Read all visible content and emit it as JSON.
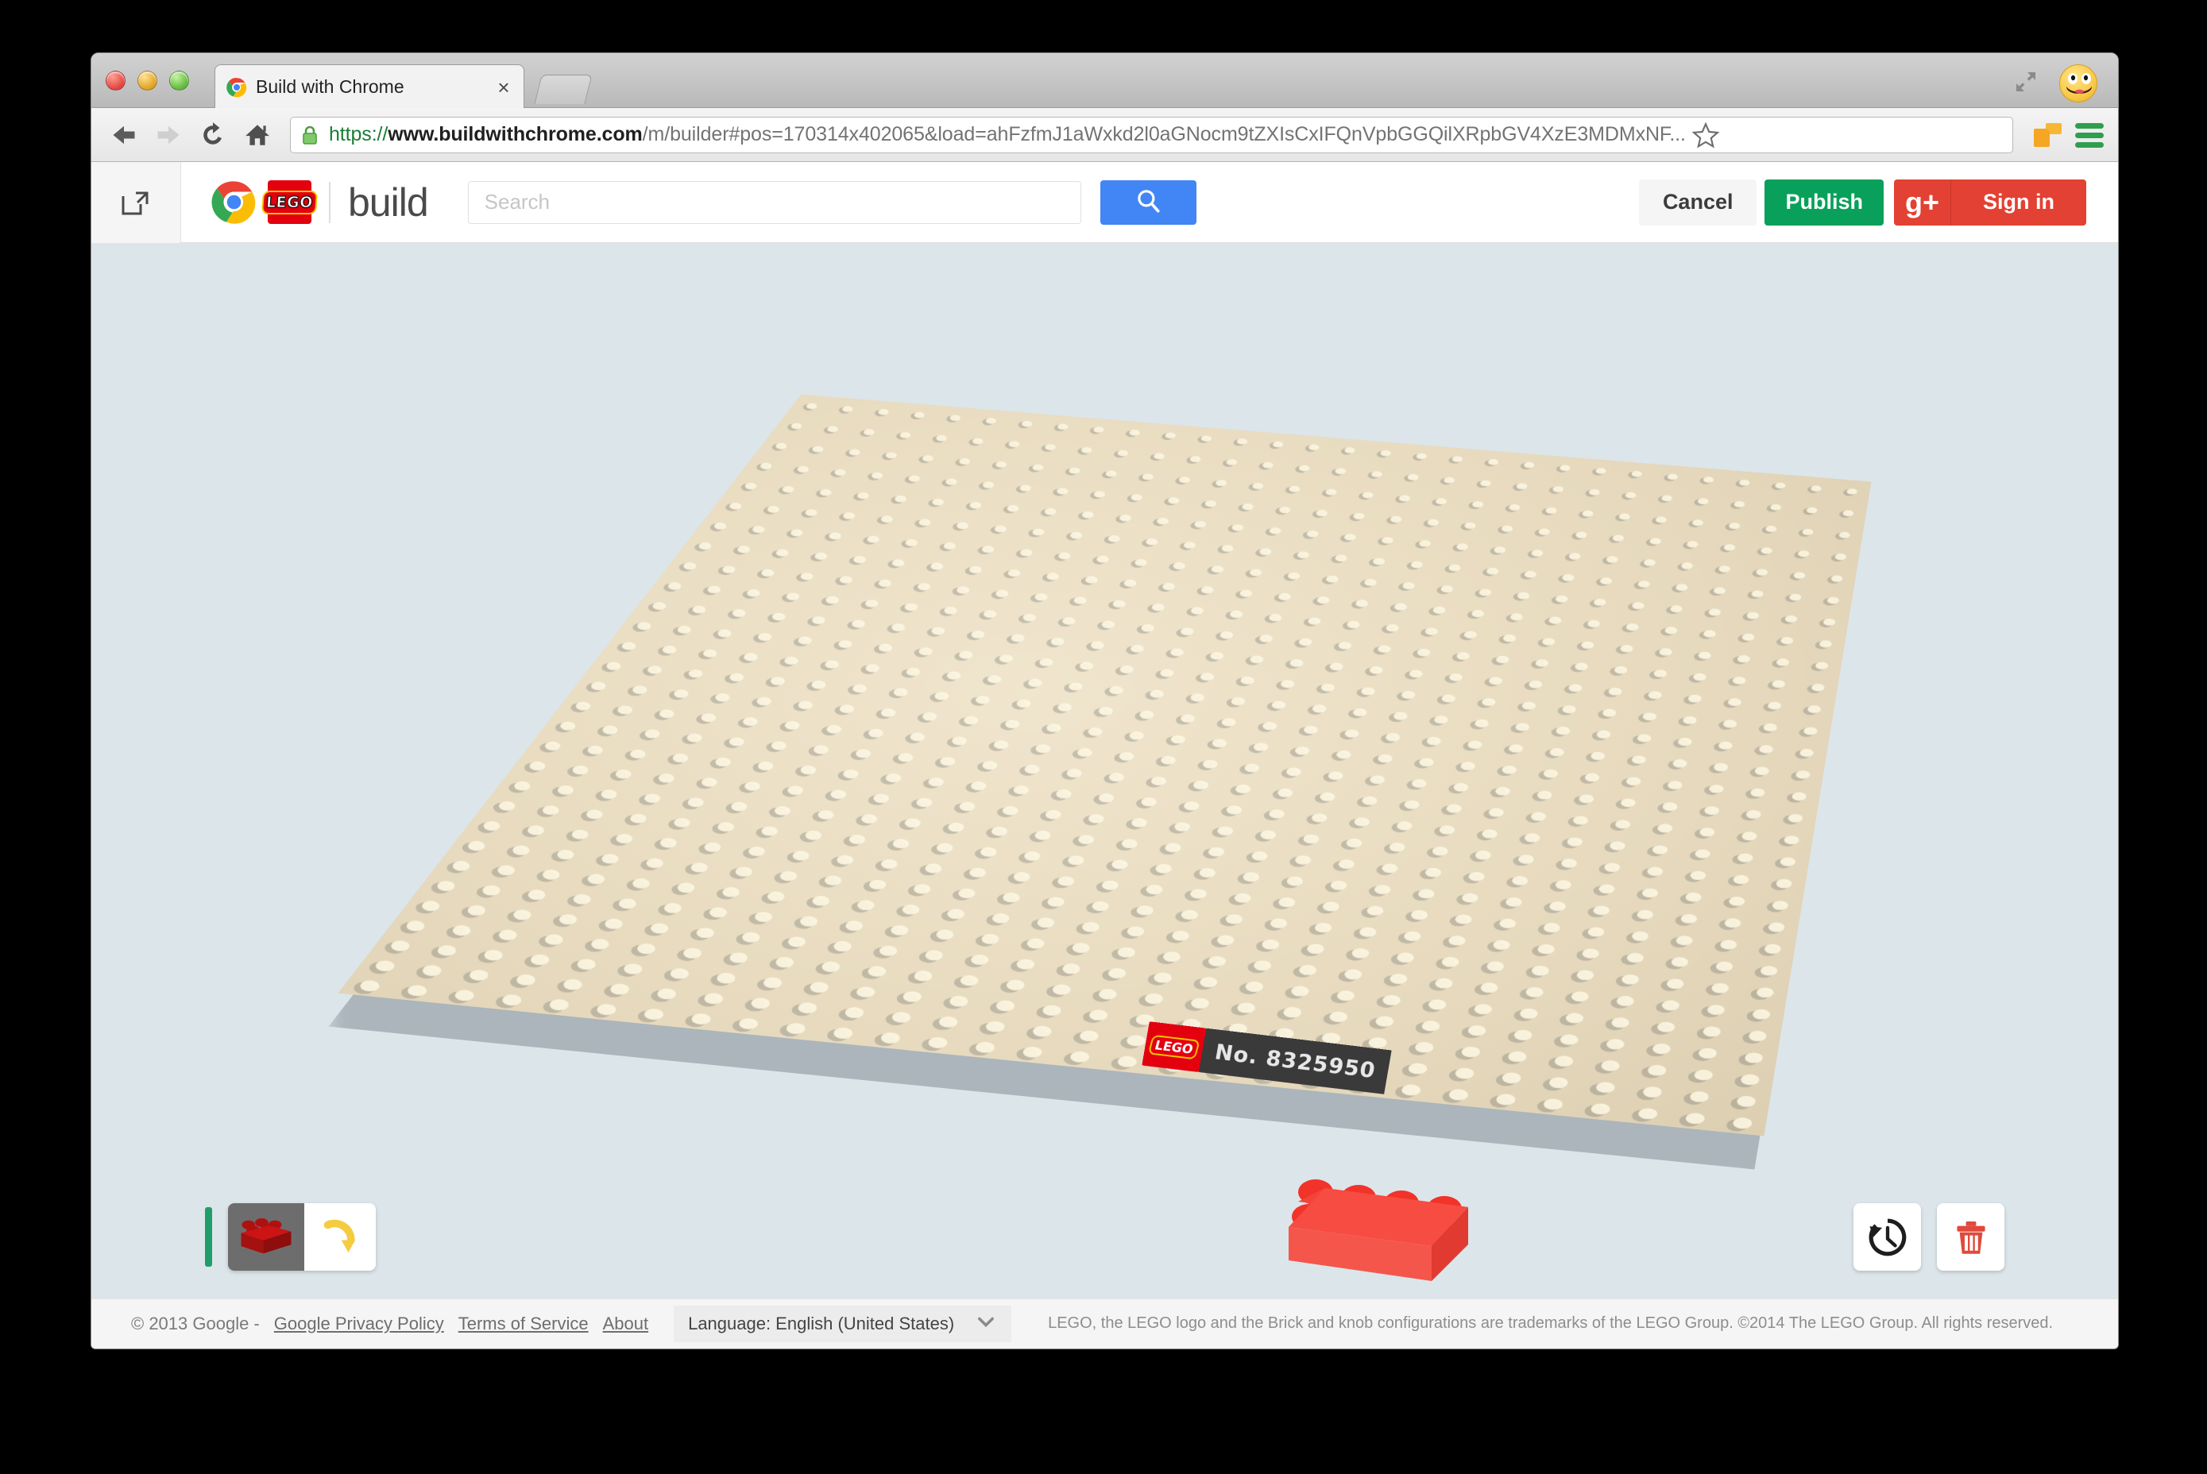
{
  "window": {
    "traffic_lights": [
      "close",
      "minimize",
      "zoom"
    ],
    "expand_icon": "fullscreen-arrows-icon",
    "profile_avatar": "awesome-face-avatar"
  },
  "tab": {
    "title": "Build with Chrome",
    "favicon": "chrome-logo-icon",
    "close_label": "×",
    "new_tab_label": "+"
  },
  "toolbar": {
    "back_label": "←",
    "forward_label": "→",
    "reload_label": "↻",
    "home_label": "⌂",
    "security_icon": "lock-icon",
    "url": {
      "scheme": "https://",
      "host": "www.buildwithchrome.com",
      "path": "/m/builder#pos=170314x402065&load=ahFzfmJ1aWxkd2l0aGNocm9tZXIsCxIFQnVpbGGQilXRpbGV4XzE3MDMxNF...",
      "full": "https://www.buildwithchrome.com/m/builder#pos=170314x402065&load=ahFzfmJ1aWxkd2l0aGNocm9tZXIsCxIFQnVpbGGQilXRpbGV4XzE3MDMxNF..."
    },
    "star_icon": "star-bookmark-icon",
    "bookmarks_icon": "bookmarks-folder-icon",
    "menu_icon": "hamburger-menu-icon"
  },
  "app_header": {
    "expand_pane_icon": "open-panel-icon",
    "chrome_logo": "chrome-logo-icon",
    "lego_logo": "LEGO",
    "brand_name": "build",
    "search": {
      "placeholder": "Search",
      "value": "",
      "button_icon": "search-icon"
    },
    "cancel_label": "Cancel",
    "publish_label": "Publish",
    "gplus_label": "g+",
    "signin_label": "Sign in"
  },
  "builder": {
    "background_color": "#dce5ea",
    "baseplate_color": "#e8dcc0",
    "badge": {
      "brand": "LEGO",
      "number": "No. 8325950"
    },
    "brick": {
      "color": "#f44336",
      "studs": "2x4",
      "name": "red-2x4-brick"
    },
    "palette": {
      "indicator_color": "#1f9e6b",
      "selected_brick_icon": "red-brick-icon",
      "rotate_icon": "rotate-arrow-icon"
    },
    "tools": [
      {
        "name": "history-undo-button",
        "icon": "history-clock-icon"
      },
      {
        "name": "delete-button",
        "icon": "trash-icon"
      }
    ]
  },
  "footer": {
    "copyright": "© 2013 Google  -",
    "links": [
      "Google Privacy Policy",
      "Terms of Service",
      "About"
    ],
    "language_label": "Language: English (United States)",
    "language_chevron": "chevron-down-icon",
    "legal": "LEGO, the LEGO logo and the Brick and knob configurations are trademarks of the LEGO Group. ©2014 The LEGO Group. All rights reserved."
  }
}
